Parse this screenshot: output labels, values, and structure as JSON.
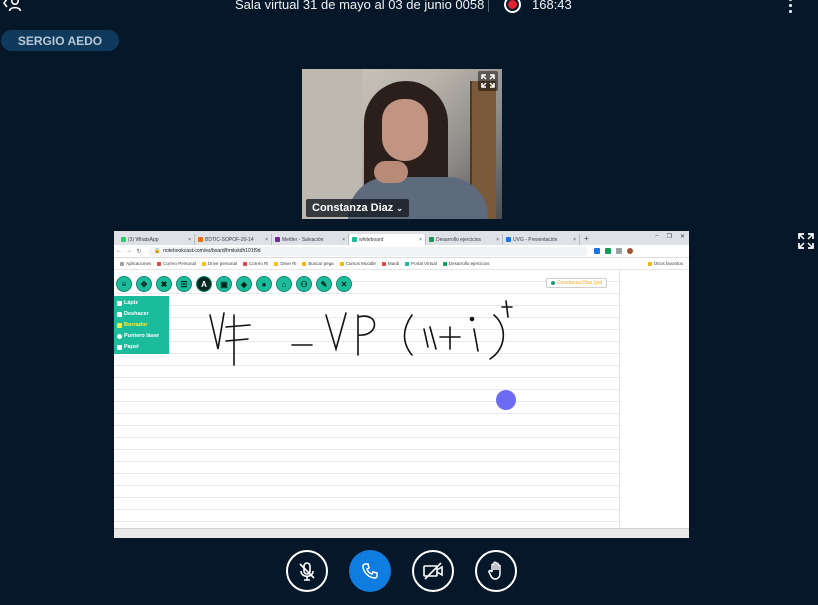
{
  "topbar": {
    "meeting_title": "Sala virtual 31 de mayo al 03 de junio 0058",
    "recording_time": "168:43",
    "recording_color": "#e22134"
  },
  "talker": {
    "name": "SERGIO AEDO"
  },
  "webcam": {
    "user_name": "Constanza Diaz"
  },
  "browser": {
    "tabs": [
      {
        "label": "(3) WhatsApp",
        "color": "#25d366"
      },
      {
        "label": "BDTIC-SOPOF-20-14",
        "color": "#e8710a"
      },
      {
        "label": "Mettler - Salvación",
        "color": "#7b1fa2"
      },
      {
        "label": "whiteboard",
        "color": "#1abc9c"
      },
      {
        "label": "Desarrollo ejercicios",
        "color": "#0f9d58"
      },
      {
        "label": "UVG - Presentación",
        "color": "#1a73e8"
      }
    ],
    "url": "notebookcast.com/es/board/frmkxtdh101f9d",
    "bookmarks": [
      "Aplicaciones",
      "Correo Personal",
      "Drive personal",
      "Correo Ri",
      "Drive Ri",
      "Buscar pega",
      "Cursos Moodle",
      "Mardi",
      "Portal Virtual",
      "Desarrollo ejercicios",
      "Otros favoritos"
    ]
  },
  "whiteboard": {
    "active_user": "Constanza Diaz (yo)",
    "menu": [
      "Lápiz",
      "Deshacer",
      "Borrador",
      "Puntero láser",
      "Papel"
    ],
    "toolbar": [
      "menu-icon",
      "move-icon",
      "erase-icon",
      "lines-icon",
      "text-icon",
      "image-icon",
      "shapes-icon",
      "comment-icon",
      "save-icon",
      "users-icon",
      "settings-icon",
      "close-icon"
    ],
    "accent_color": "#1abc9c",
    "pointer_color": "#6c6cf2"
  }
}
